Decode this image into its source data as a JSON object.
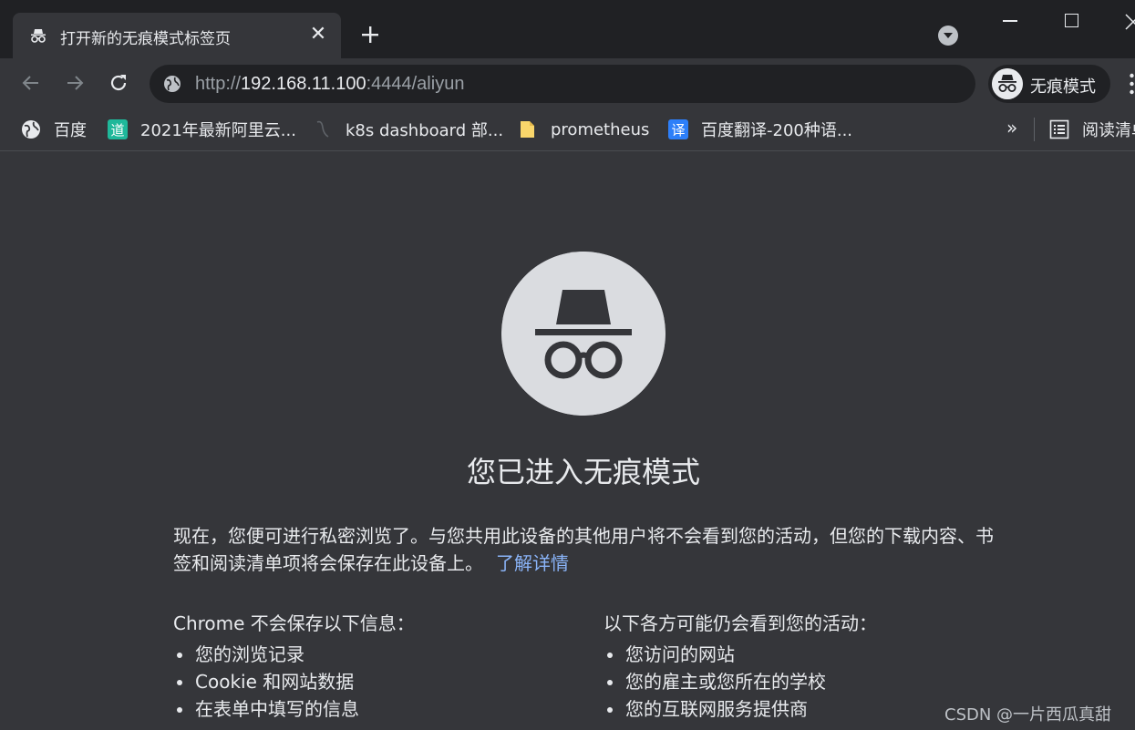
{
  "tab": {
    "title": "打开新的无痕模式标签页",
    "close_glyph": "✕"
  },
  "toolbar": {
    "url_scheme": "http://",
    "url_host": "192.168.11.100",
    "url_rest": ":4444/aliyun",
    "incognito_label": "无痕模式"
  },
  "bookmarks": [
    {
      "label": "百度",
      "icon": "globe-icon"
    },
    {
      "label": "2021年最新阿里云...",
      "icon": "dao-icon"
    },
    {
      "label": "k8s dashboard 部...",
      "icon": "blank-page-icon"
    },
    {
      "label": "prometheus",
      "icon": "folder-icon"
    },
    {
      "label": "百度翻译-200种语...",
      "icon": "translate-icon"
    }
  ],
  "bookmarks_overflow": "»",
  "reading_list_label": "阅读清单",
  "content": {
    "heading": "您已进入无痕模式",
    "intro": "现在，您便可进行私密浏览了。与您共用此设备的其他用户将不会看到您的活动，但您的下载内容、书签和阅读清单项将会保存在此设备上。",
    "learn_more": "了解详情",
    "left_title": "Chrome 不会保存以下信息：",
    "left_items": [
      "您的浏览记录",
      "Cookie 和网站数据",
      "在表单中填写的信息"
    ],
    "right_title": "以下各方可能仍会看到您的活动：",
    "right_items": [
      "您访问的网站",
      "您的雇主或您所在的学校",
      "您的互联网服务提供商"
    ]
  },
  "watermark": "CSDN @一片西瓜真甜",
  "colors": {
    "frame": "#202124",
    "page": "#35363a",
    "text": "#e8eaed",
    "link": "#8ab4f8"
  }
}
